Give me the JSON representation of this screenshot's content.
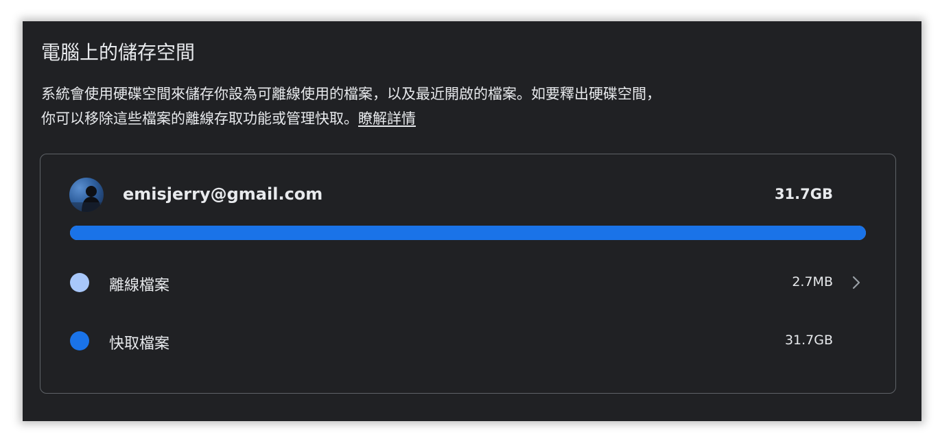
{
  "section": {
    "title": "電腦上的儲存空間",
    "description_line1": "系統會使用硬碟空間來儲存你設為可離線使用的檔案，以及最近開啟的檔案。如要釋出硬碟空間，",
    "description_line2": "你可以移除這些檔案的離線存取功能或管理快取。",
    "learn_more": "瞭解詳情"
  },
  "account": {
    "email": "emisjerry@gmail.com",
    "total_size": "31.7GB",
    "usage_cached_fraction": 0.9999
  },
  "rows": [
    {
      "label": "離線檔案",
      "size": "2.7MB",
      "dot_color": "#a8c7fa",
      "icon": "chevron-right-icon"
    },
    {
      "label": "快取檔案",
      "size": "31.7GB",
      "dot_color": "#1a73e8"
    }
  ],
  "colors": {
    "panel_bg": "#202124",
    "text": "#e8eaed",
    "bar_cached": "#1a73e8",
    "bar_offline": "#a8c7fa",
    "card_border": "#5f6368"
  }
}
